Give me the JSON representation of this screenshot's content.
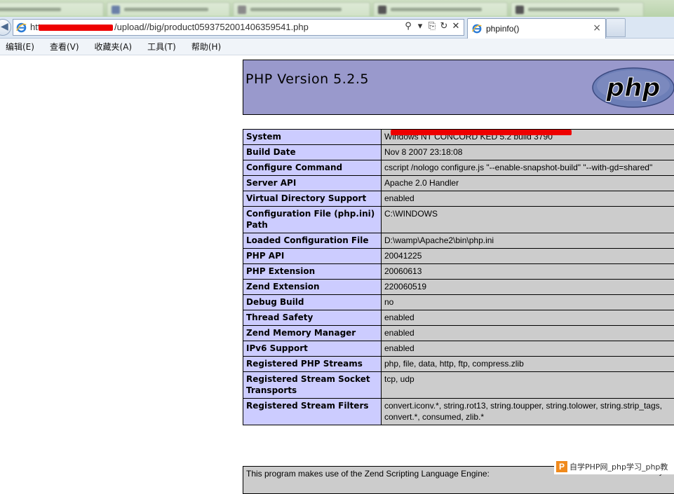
{
  "browser": {
    "address_url": "http://                    /upload//big/product0593752001406359541.php",
    "address_url_visible": "/upload//big/product0593752001406359541.php",
    "address_prefix": "htt",
    "tab_title": "phpinfo()",
    "tab_close": "×",
    "search_glyph": "⚲",
    "dropdown_glyph": "▾",
    "compat_glyph": "⎘",
    "refresh_glyph": "↻",
    "stop_glyph": "✕",
    "back_glyph": "◀"
  },
  "menu": {
    "items": [
      "编辑(E)",
      "查看(V)",
      "收藏夹(A)",
      "工具(T)",
      "帮助(H)"
    ]
  },
  "phpinfo": {
    "version_title": "PHP Version 5.2.5",
    "logo_text": "php",
    "rows": [
      {
        "key": "System",
        "value": "Windows NT CONCORD  KED 5.2 build 3790"
      },
      {
        "key": "Build Date",
        "value": "Nov 8 2007 23:18:08"
      },
      {
        "key": "Configure Command",
        "value": "cscript /nologo configure.js \"--enable-snapshot-build\" \"--with-gd=shared\""
      },
      {
        "key": "Server API",
        "value": "Apache 2.0 Handler"
      },
      {
        "key": "Virtual Directory Support",
        "value": "enabled"
      },
      {
        "key": "Configuration File (php.ini) Path",
        "value": "C:\\WINDOWS"
      },
      {
        "key": "Loaded Configuration File",
        "value": "D:\\wamp\\Apache2\\bin\\php.ini"
      },
      {
        "key": "PHP API",
        "value": "20041225"
      },
      {
        "key": "PHP Extension",
        "value": "20060613"
      },
      {
        "key": "Zend Extension",
        "value": "220060519"
      },
      {
        "key": "Debug Build",
        "value": "no"
      },
      {
        "key": "Thread Safety",
        "value": "enabled"
      },
      {
        "key": "Zend Memory Manager",
        "value": "enabled"
      },
      {
        "key": "IPv6 Support",
        "value": "enabled"
      },
      {
        "key": "Registered PHP Streams",
        "value": "php, file, data, http, ftp, compress.zlib"
      },
      {
        "key": "Registered Stream Socket Transports",
        "value": "tcp, udp"
      },
      {
        "key": "Registered Stream Filters",
        "value": "convert.iconv.*, string.rot13, string.toupper, string.tolower, string.strip_tags, convert.*, consumed, zlib.*"
      }
    ],
    "zend_text": "This program makes use of the Zend Scripting Language Engine:",
    "powered_by": "Powered By"
  },
  "watermark": {
    "logo": "P",
    "text": "自学PHP网_php学习_php教"
  },
  "colors": {
    "header_bg": "#9999cc",
    "key_bg": "#ccccff",
    "value_bg": "#cccccc",
    "redaction": "#ee0000"
  }
}
